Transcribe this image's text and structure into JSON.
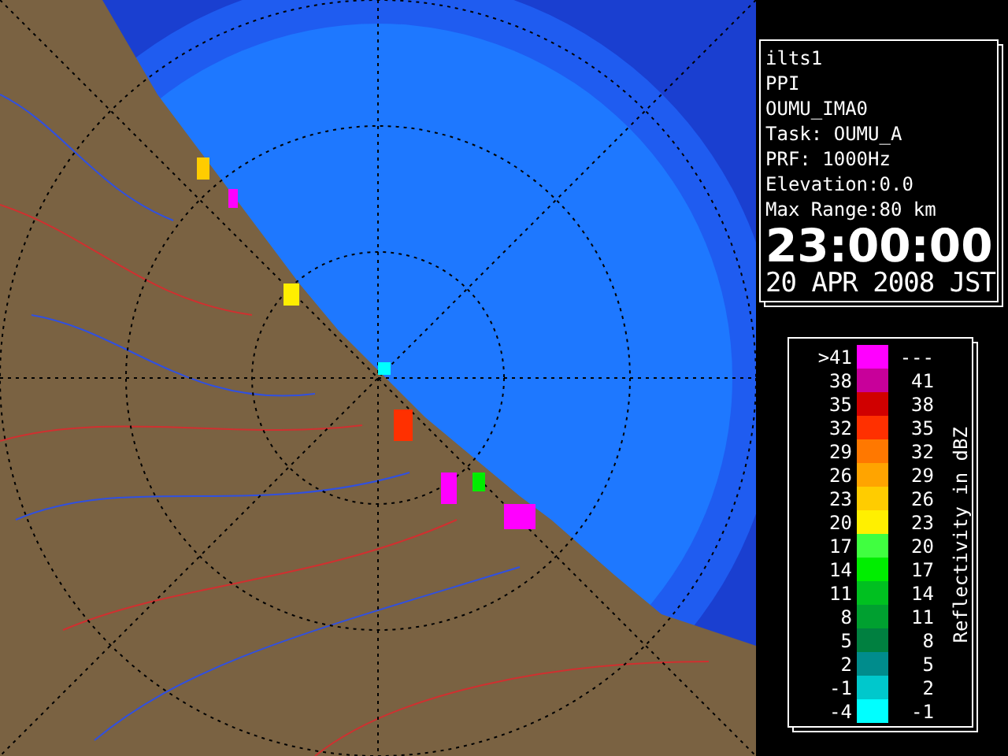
{
  "info": {
    "lines": [
      "ilts1",
      "PPI",
      "OUMU_IMA0",
      "Task: OUMU_A",
      "PRF: 1000Hz",
      "Elevation:0.0",
      "Max Range:80 km"
    ],
    "time": "23:00:00",
    "date": "20 APR 2008 JST"
  },
  "legend": {
    "title": "Reflectivity in dBZ",
    "rows": [
      {
        "low": ">41",
        "high": "---",
        "color": "#ff00ff"
      },
      {
        "low": "38",
        "high": "41",
        "color": "#c8009a"
      },
      {
        "low": "35",
        "high": "38",
        "color": "#d00000"
      },
      {
        "low": "32",
        "high": "35",
        "color": "#ff3000"
      },
      {
        "low": "29",
        "high": "32",
        "color": "#ff7800"
      },
      {
        "low": "26",
        "high": "29",
        "color": "#ffa400"
      },
      {
        "low": "23",
        "high": "26",
        "color": "#ffcc00"
      },
      {
        "low": "20",
        "high": "23",
        "color": "#fff000"
      },
      {
        "low": "17",
        "high": "20",
        "color": "#40ff40"
      },
      {
        "low": "14",
        "high": "17",
        "color": "#00ee00"
      },
      {
        "low": "11",
        "high": "14",
        "color": "#00c020"
      },
      {
        "low": "8",
        "high": "11",
        "color": "#00a030"
      },
      {
        "low": "5",
        "high": "8",
        "color": "#008040"
      },
      {
        "low": "2",
        "high": "5",
        "color": "#008c8c"
      },
      {
        "low": "-1",
        "high": "2",
        "color": "#00c8cc"
      },
      {
        "low": "-4",
        "high": "-1",
        "color": "#00ffff"
      }
    ]
  }
}
